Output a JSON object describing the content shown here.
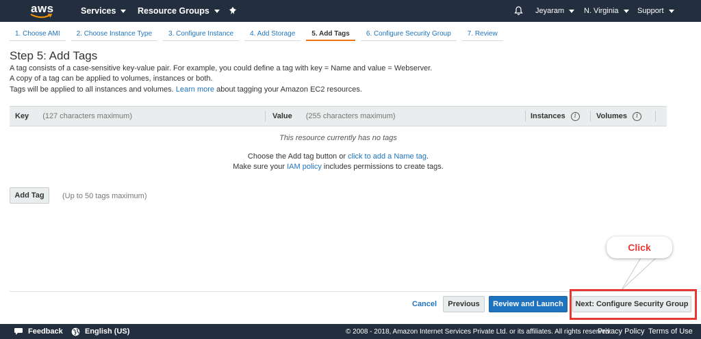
{
  "topnav": {
    "logo": "aws",
    "services": "Services",
    "resource_groups": "Resource Groups",
    "user": "Jeyaram",
    "region": "N. Virginia",
    "support": "Support"
  },
  "tabs": [
    {
      "label": "1. Choose AMI"
    },
    {
      "label": "2. Choose Instance Type"
    },
    {
      "label": "3. Configure Instance"
    },
    {
      "label": "4. Add Storage"
    },
    {
      "label": "5. Add Tags"
    },
    {
      "label": "6. Configure Security Group"
    },
    {
      "label": "7. Review"
    }
  ],
  "page": {
    "title": "Step 5: Add Tags",
    "desc1": "A tag consists of a case-sensitive key-value pair. For example, you could define a tag with key = Name and value = Webserver.",
    "desc2": "A copy of a tag can be applied to volumes, instances or both.",
    "desc3_pre": "Tags will be applied to all instances and volumes.",
    "desc3_link": "Learn more",
    "desc3_post": "about tagging your Amazon EC2 resources."
  },
  "table": {
    "key_label": "Key",
    "key_hint": "(127 characters maximum)",
    "value_label": "Value",
    "value_hint": "(255 characters maximum)",
    "instances_label": "Instances",
    "volumes_label": "Volumes",
    "empty_text": "This resource currently has no tags",
    "help1_pre": "Choose the Add tag button or",
    "help1_link": "click to add a Name tag",
    "help1_post": ".",
    "help2_pre": "Make sure your",
    "help2_link": "IAM policy",
    "help2_post": "includes permissions to create tags."
  },
  "add_tag": {
    "button": "Add Tag",
    "hint": "(Up to 50 tags maximum)"
  },
  "actions": {
    "cancel": "Cancel",
    "previous": "Previous",
    "review_launch": "Review and Launch",
    "next": "Next: Configure Security Group"
  },
  "annotation": {
    "callout": "Click",
    "color": "#e53935"
  },
  "footer": {
    "feedback": "Feedback",
    "language": "English (US)",
    "copyright": "© 2008 - 2018, Amazon Internet Services Private Ltd. or its affiliates. All rights reserved.",
    "privacy": "Privacy Policy",
    "terms": "Terms of Use"
  },
  "colors": {
    "nav_bg": "#232f3e",
    "link": "#1e73be",
    "active_tab": "#ec7211",
    "primary": "#1e73be"
  }
}
